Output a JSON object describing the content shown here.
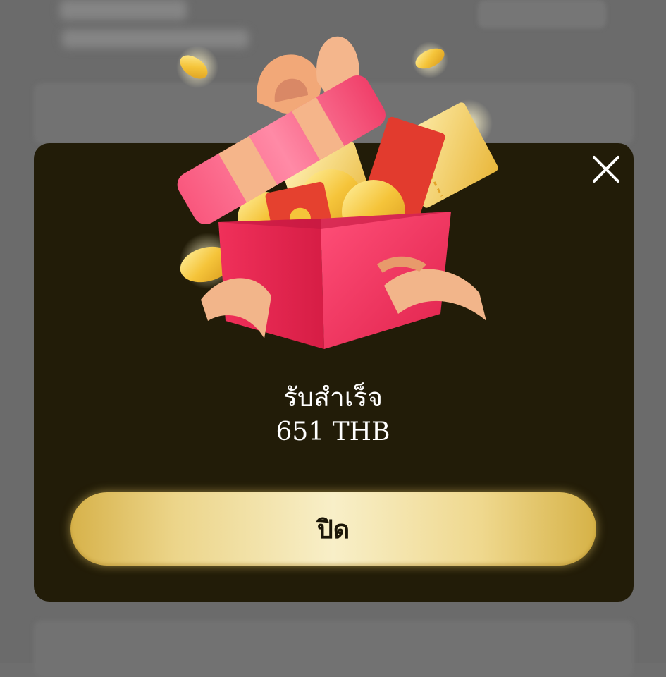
{
  "dialog": {
    "title": "รับสำเร็จ",
    "amount": "651 THB",
    "close_button_label": "ปิด"
  },
  "icons": {
    "close": "close-icon",
    "gift": "gift-box-illustration"
  },
  "colors": {
    "modal_background": "#221c08",
    "button_gold": "#ecd58a",
    "overlay": "#6b6b6b",
    "gift_red": "#f0305a",
    "ribbon": "#f2b58a",
    "coin_gold": "#f5c43a"
  }
}
